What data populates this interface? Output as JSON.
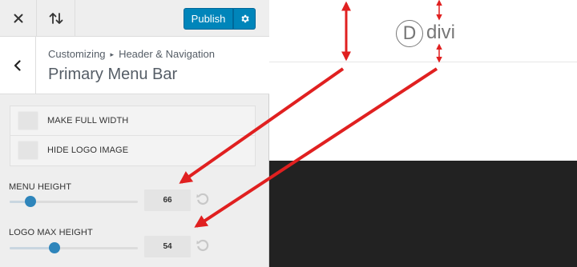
{
  "toolbar": {
    "close_icon": "close-icon",
    "sort_icon": "sort-arrows-icon",
    "publish_label": "Publish",
    "settings_icon": "gear-icon"
  },
  "header": {
    "back_icon": "chevron-left-icon",
    "breadcrumb_root": "Customizing",
    "breadcrumb_separator": "▸",
    "breadcrumb_section": "Header & Navigation",
    "title": "Primary Menu Bar"
  },
  "options": {
    "full_width_label": "MAKE FULL WIDTH",
    "hide_logo_label": "HIDE LOGO IMAGE"
  },
  "menu_height": {
    "label": "MENU HEIGHT",
    "value": "66",
    "slider_fraction": 0.16,
    "reset_icon": "reset-undo-icon"
  },
  "logo_max_height": {
    "label": "LOGO MAX HEIGHT",
    "value": "54",
    "slider_fraction": 0.35,
    "reset_icon": "reset-undo-icon"
  },
  "preview": {
    "logo_letter": "D",
    "logo_text": "divi"
  },
  "colors": {
    "accent": "#0085ba",
    "slider_thumb": "#2e85bb",
    "annotation_red": "#e02020",
    "preview_dark": "#222222"
  }
}
